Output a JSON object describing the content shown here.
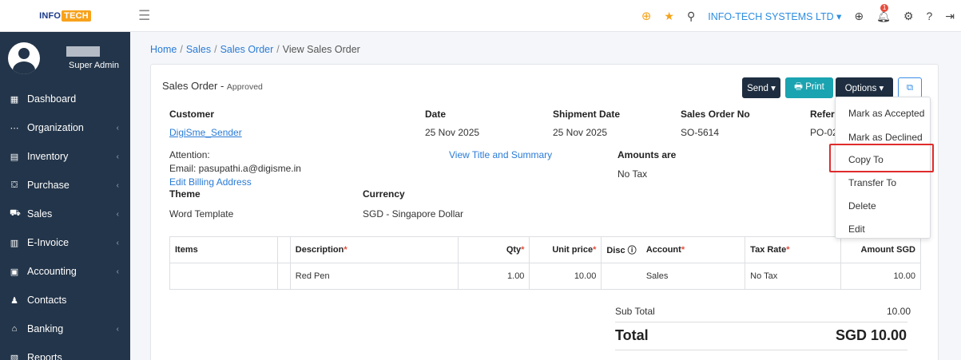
{
  "brand": {
    "logo_left": "INFO",
    "logo_right": "TECH"
  },
  "user": {
    "role": "Super Admin"
  },
  "sidebar": {
    "items": [
      {
        "label": "Dashboard",
        "icon": "dashboard-icon",
        "glyph": "▦",
        "caret": ""
      },
      {
        "label": "Organization",
        "icon": "organization-icon",
        "glyph": "⋯",
        "caret": "‹"
      },
      {
        "label": "Inventory",
        "icon": "inventory-icon",
        "glyph": "▤",
        "caret": "‹"
      },
      {
        "label": "Purchase",
        "icon": "purchase-icon",
        "glyph": "⛋",
        "caret": "‹"
      },
      {
        "label": "Sales",
        "icon": "sales-icon",
        "glyph": "⛟",
        "caret": "‹"
      },
      {
        "label": "E-Invoice",
        "icon": "einvoice-icon",
        "glyph": "▥",
        "caret": "‹"
      },
      {
        "label": "Accounting",
        "icon": "accounting-icon",
        "glyph": "▣",
        "caret": "‹"
      },
      {
        "label": "Contacts",
        "icon": "contacts-icon",
        "glyph": "♟",
        "caret": ""
      },
      {
        "label": "Banking",
        "icon": "banking-icon",
        "glyph": "⌂",
        "caret": "‹"
      },
      {
        "label": "Reports",
        "icon": "reports-icon",
        "glyph": "▧",
        "caret": ""
      }
    ]
  },
  "topbar": {
    "company": "INFO-TECH SYSTEMS LTD ▾",
    "notification_count": "1"
  },
  "breadcrumb": {
    "home": "Home",
    "sales": "Sales",
    "sales_order": "Sales Order",
    "current": "View Sales Order"
  },
  "order": {
    "title": "Sales Order - ",
    "status": "Approved",
    "customer_label": "Customer",
    "customer": "DigiSme_Sender",
    "date_label": "Date",
    "date": "25 Nov 2025",
    "shipment_label": "Shipment Date",
    "shipment_date": "25 Nov 2025",
    "so_label": "Sales Order No",
    "so_no": "SO-5614",
    "ref_label": "Refere",
    "ref_value": "PO-02",
    "attention_label": "Attention:",
    "email_line": "Email: pasupathi.a@digisme.in",
    "edit_billing": "Edit Billing Address",
    "view_title": "View Title and Summary",
    "amounts_label": "Amounts are",
    "amounts_value": "No Tax",
    "theme_label": "Theme",
    "theme_value": "Word Template",
    "currency_label": "Currency",
    "currency_value": "SGD - Singapore Dollar"
  },
  "buttons": {
    "send": "Send ▾",
    "print": "🖶 Print",
    "options": "Options ▾",
    "copy": "⧉"
  },
  "table": {
    "headers": {
      "items": "Items",
      "description": "Description",
      "qty": "Qty",
      "unit_price": "Unit price",
      "disc": "Disc",
      "account": "Account",
      "tax_rate": "Tax Rate",
      "amount": "Amount SGD"
    },
    "rows": [
      {
        "items": "",
        "description": "Red Pen",
        "qty": "1.00",
        "unit_price": "10.00",
        "disc": "",
        "account": "Sales",
        "tax_rate": "No Tax",
        "amount": "10.00"
      }
    ]
  },
  "totals": {
    "subtotal_label": "Sub Total",
    "subtotal": "10.00",
    "total_label": "Total",
    "total": "SGD 10.00"
  },
  "dropdown": {
    "items": [
      "Mark as Accepted",
      "Mark as Declined",
      "Copy To",
      "Transfer To",
      "Delete",
      "Edit"
    ]
  }
}
